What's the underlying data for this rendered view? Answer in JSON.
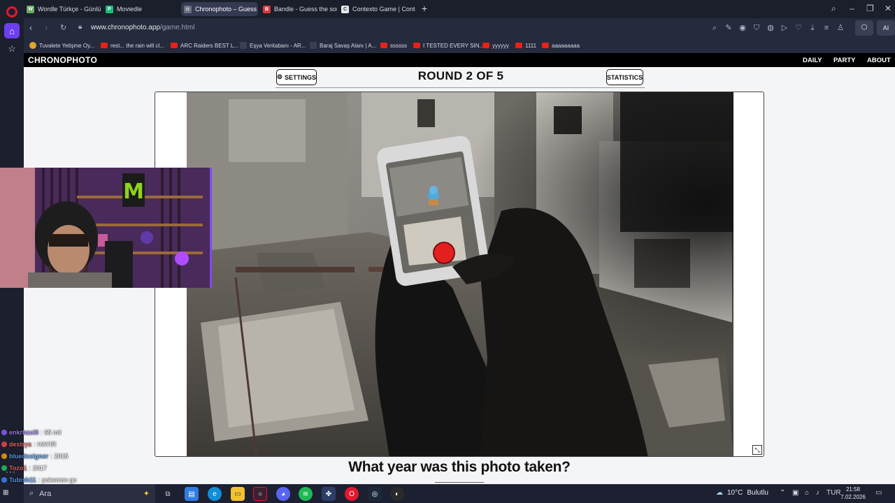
{
  "tabs": [
    {
      "title": "Wordle Türkçe - Günlük K",
      "favicon": "W",
      "color": "#6aaa64",
      "active": false
    },
    {
      "title": "Moviedle",
      "favicon": "P",
      "color": "#1bbf7a",
      "active": false
    },
    {
      "title": "Chronophoto – Guess the",
      "favicon": "camera",
      "color": "#6b7280",
      "active": true
    },
    {
      "title": "Bandle - Guess the song",
      "favicon": "B",
      "color": "#d63c3c",
      "active": false
    },
    {
      "title": "Contexto Game | Contexto",
      "favicon": "C",
      "color": "#e5e7eb",
      "active": false
    }
  ],
  "address": {
    "domain": "www.chronophoto.app",
    "path": "/game.html",
    "ai_label": "AI"
  },
  "bookmarks": [
    {
      "label": "Tuvalete Yetişme Oy...",
      "icon": "trophy-icon"
    },
    {
      "label": "rest... the rain will cl...",
      "icon": "youtube-icon"
    },
    {
      "label": "ARC Raiders BEST L...",
      "icon": "youtube-icon"
    },
    {
      "label": "Eşya Veritabanı - AR...",
      "icon": "arc-icon"
    },
    {
      "label": "Baraj Savaş Alanı | A...",
      "icon": "arc-icon"
    },
    {
      "label": "ssssss",
      "icon": "youtube-icon"
    },
    {
      "label": "I TESTED EVERY SIN...",
      "icon": "youtube-icon"
    },
    {
      "label": "yyyyyy",
      "icon": "youtube-icon"
    },
    {
      "label": "1111",
      "icon": "youtube-icon"
    },
    {
      "label": "aaaaaaaaa",
      "icon": "youtube-icon"
    }
  ],
  "site": {
    "brand": "CHRONOPHOTO",
    "nav": [
      "DAILY",
      "PARTY",
      "ABOUT"
    ],
    "settings_label": "SETTINGS",
    "statistics_label": "STATISTICS",
    "round_label": "ROUND 2 OF 5",
    "question": "What year was this photo taken?"
  },
  "chat": [
    {
      "user": "enkrhacili",
      "message": "65 mil",
      "color": "#8b5cf6"
    },
    {
      "user": "destrys",
      "message": "HAYIR",
      "color": "#ef4444"
    },
    {
      "user": "bluedesigner",
      "message": "2015",
      "color": "#3b82f6"
    },
    {
      "user": "Tozo1",
      "message": "2017",
      "color": "#ef4444"
    },
    {
      "user": "Tubish11",
      "message": "pokemon go",
      "color": "#3b82f6"
    }
  ],
  "taskbar": {
    "search_label": "Ara",
    "weather": "10°C",
    "weather_desc": "Bulutlu",
    "lang": "TUR",
    "time": "21:58",
    "date": "7.02.2026"
  },
  "colors": {
    "accent": "#6d3ff0",
    "opera_red": "#e2182f",
    "page_bg": "#f4f5f7",
    "header_bg": "#000000"
  }
}
